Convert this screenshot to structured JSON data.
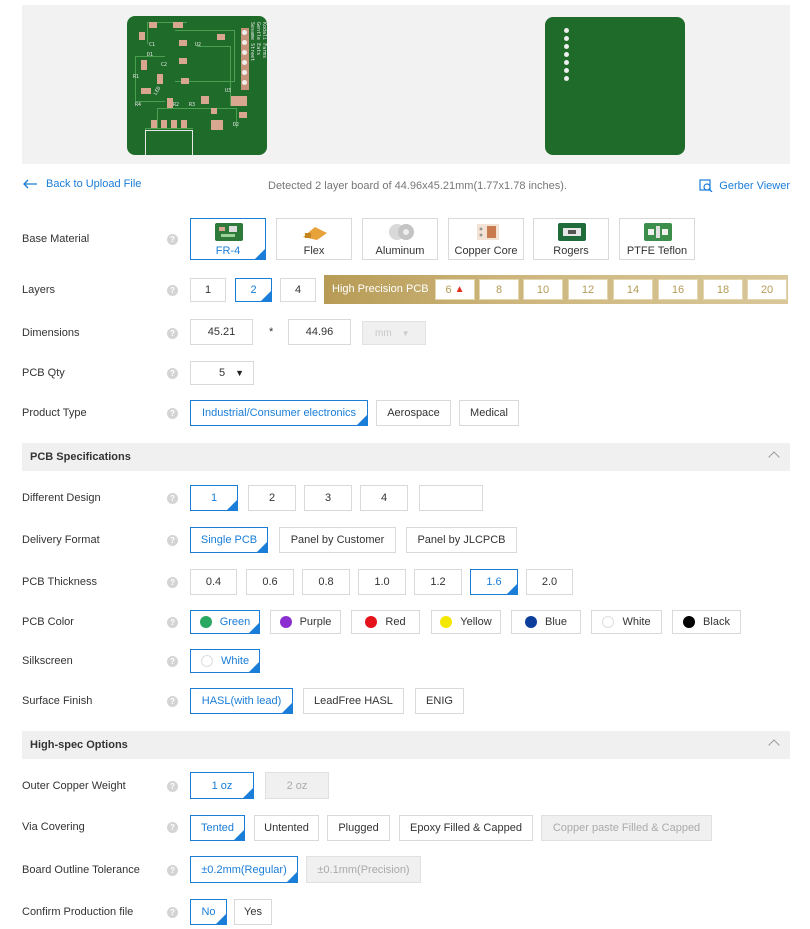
{
  "toolbar": {
    "back_label": "Back to Upload File",
    "detected_text": "Detected 2 layer board of 44.96x45.21mm(1.77x1.78 inches).",
    "gerber_label": "Gerber Viewer"
  },
  "preview": {
    "top_silk": [
      "Sesame Street",
      "Gentle Eats",
      "Kodali Farms",
      "U2",
      "U3",
      "C1",
      "C2",
      "R1",
      "R2",
      "R3",
      "R4",
      "D1",
      "D2",
      "LED"
    ]
  },
  "base_material": {
    "label": "Base Material",
    "options": [
      "FR-4",
      "Flex",
      "Aluminum",
      "Copper Core",
      "Rogers",
      "PTFE Teflon"
    ],
    "selected": "FR-4"
  },
  "layers": {
    "label": "Layers",
    "options": [
      "1",
      "2",
      "4"
    ],
    "selected": "2",
    "high_precision_label": "High Precision PCB",
    "high_precision_options": [
      "6",
      "8",
      "10",
      "12",
      "14",
      "16",
      "18",
      "20"
    ]
  },
  "dimensions": {
    "label": "Dimensions",
    "width": "45.21",
    "separator": "*",
    "height": "44.96",
    "unit": "mm"
  },
  "qty": {
    "label": "PCB Qty",
    "value": "5"
  },
  "product_type": {
    "label": "Product Type",
    "options": [
      "Industrial/Consumer electronics",
      "Aerospace",
      "Medical"
    ],
    "selected": "Industrial/Consumer electronics"
  },
  "spec_section": {
    "title": "PCB Specifications"
  },
  "different_design": {
    "label": "Different Design",
    "options": [
      "1",
      "2",
      "3",
      "4"
    ],
    "custom": "",
    "selected": "1"
  },
  "delivery_format": {
    "label": "Delivery Format",
    "options": [
      "Single PCB",
      "Panel by Customer",
      "Panel by JLCPCB"
    ],
    "selected": "Single PCB"
  },
  "thickness": {
    "label": "PCB Thickness",
    "options": [
      "0.4",
      "0.6",
      "0.8",
      "1.0",
      "1.2",
      "1.6",
      "2.0"
    ],
    "selected": "1.6"
  },
  "color": {
    "label": "PCB Color",
    "options": [
      {
        "name": "Green",
        "hex": "#2aa760"
      },
      {
        "name": "Purple",
        "hex": "#8c2fd1"
      },
      {
        "name": "Red",
        "hex": "#e3121b"
      },
      {
        "name": "Yellow",
        "hex": "#f5e800"
      },
      {
        "name": "Blue",
        "hex": "#0d3e9c"
      },
      {
        "name": "White",
        "hex": "#ffffff"
      },
      {
        "name": "Black",
        "hex": "#000000"
      }
    ],
    "selected": "Green"
  },
  "silkscreen": {
    "label": "Silkscreen",
    "options": [
      "White"
    ],
    "selected": "White"
  },
  "surface_finish": {
    "label": "Surface Finish",
    "options": [
      "HASL(with lead)",
      "LeadFree HASL",
      "ENIG"
    ],
    "selected": "HASL(with lead)"
  },
  "highspec_section": {
    "title": "High-spec Options"
  },
  "outer_copper": {
    "label": "Outer Copper Weight",
    "options": [
      "1 oz",
      "2 oz"
    ],
    "selected": "1 oz"
  },
  "via_covering": {
    "label": "Via Covering",
    "options": [
      "Tented",
      "Untented",
      "Plugged",
      "Epoxy Filled & Capped",
      "Copper paste Filled & Capped"
    ],
    "selected": "Tented"
  },
  "outline_tolerance": {
    "label": "Board Outline Tolerance",
    "options": [
      "±0.2mm(Regular)",
      "±0.1mm(Precision)"
    ],
    "selected": "±0.2mm(Regular)"
  },
  "confirm_file": {
    "label": "Confirm Production file",
    "options": [
      "No",
      "Yes"
    ],
    "selected": "No"
  },
  "help_glyph": "?",
  "colors": {
    "accent": "#1a7dd8",
    "gold": "#c4aa6a",
    "board_green": "#1f6b2a"
  }
}
